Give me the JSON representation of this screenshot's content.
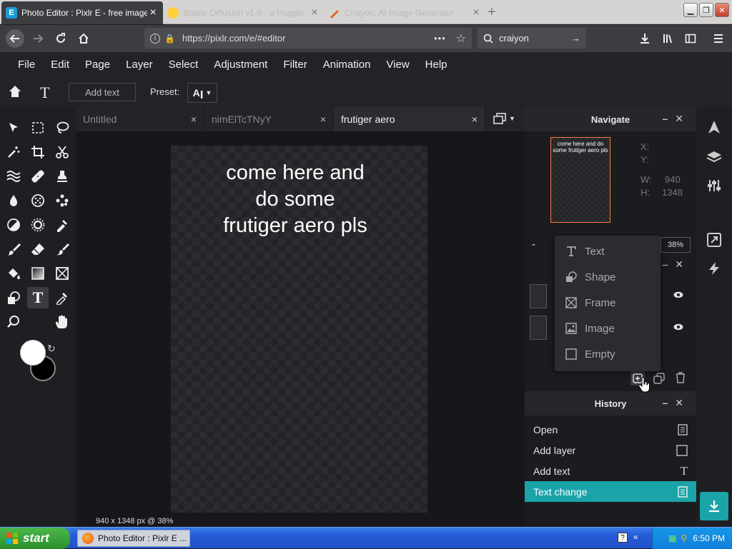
{
  "browser": {
    "tabs": [
      {
        "label": "Photo Editor : Pixlr E - free image e",
        "active": true
      },
      {
        "label": "Stable Diffusion v1-5 - a Huggin",
        "active": false
      },
      {
        "label": "Craiyon, AI Image Generator",
        "active": false
      }
    ],
    "url": "https://pixlr.com/e/#editor",
    "search_value": "craiyon"
  },
  "menu": [
    "File",
    "Edit",
    "Page",
    "Layer",
    "Select",
    "Adjustment",
    "Filter",
    "Animation",
    "View",
    "Help"
  ],
  "toolbar": {
    "add_text_label": "Add text",
    "preset_label": "Preset:"
  },
  "doc_tabs": [
    {
      "label": "Untitled",
      "active": false
    },
    {
      "label": "nimElTcTNyY",
      "active": false
    },
    {
      "label": "frutiger aero",
      "active": true
    }
  ],
  "canvas": {
    "text_lines": [
      "come here and",
      "do some",
      "frutiger aero pls"
    ],
    "info": "940 x 1348 px @ 38%"
  },
  "navigate": {
    "title": "Navigate",
    "thumb_text": "come here and do some frutiger aero pls",
    "x_label": "X:",
    "y_label": "Y:",
    "w_label": "W:",
    "w_value": "940",
    "h_label": "H:",
    "h_value": "1348",
    "zoom_minus": "-",
    "zoom_value": "38%"
  },
  "add_menu": [
    {
      "label": "Text",
      "icon": "text-icon"
    },
    {
      "label": "Shape",
      "icon": "shape-icon"
    },
    {
      "label": "Frame",
      "icon": "frame-icon"
    },
    {
      "label": "Image",
      "icon": "image-icon"
    },
    {
      "label": "Empty",
      "icon": "empty-layer-icon"
    }
  ],
  "history": {
    "title": "History",
    "items": [
      {
        "label": "Open",
        "active": false
      },
      {
        "label": "Add layer",
        "active": false
      },
      {
        "label": "Add text",
        "active": false
      },
      {
        "label": "Text change",
        "active": true
      }
    ]
  },
  "taskbar": {
    "start_label": "start",
    "task_label": "Photo Editor : Pixlr E ...",
    "time": "6:50 PM"
  },
  "colors": {
    "accent": "#1aa3a8",
    "nav_thumb_border": "#ff7a40"
  }
}
